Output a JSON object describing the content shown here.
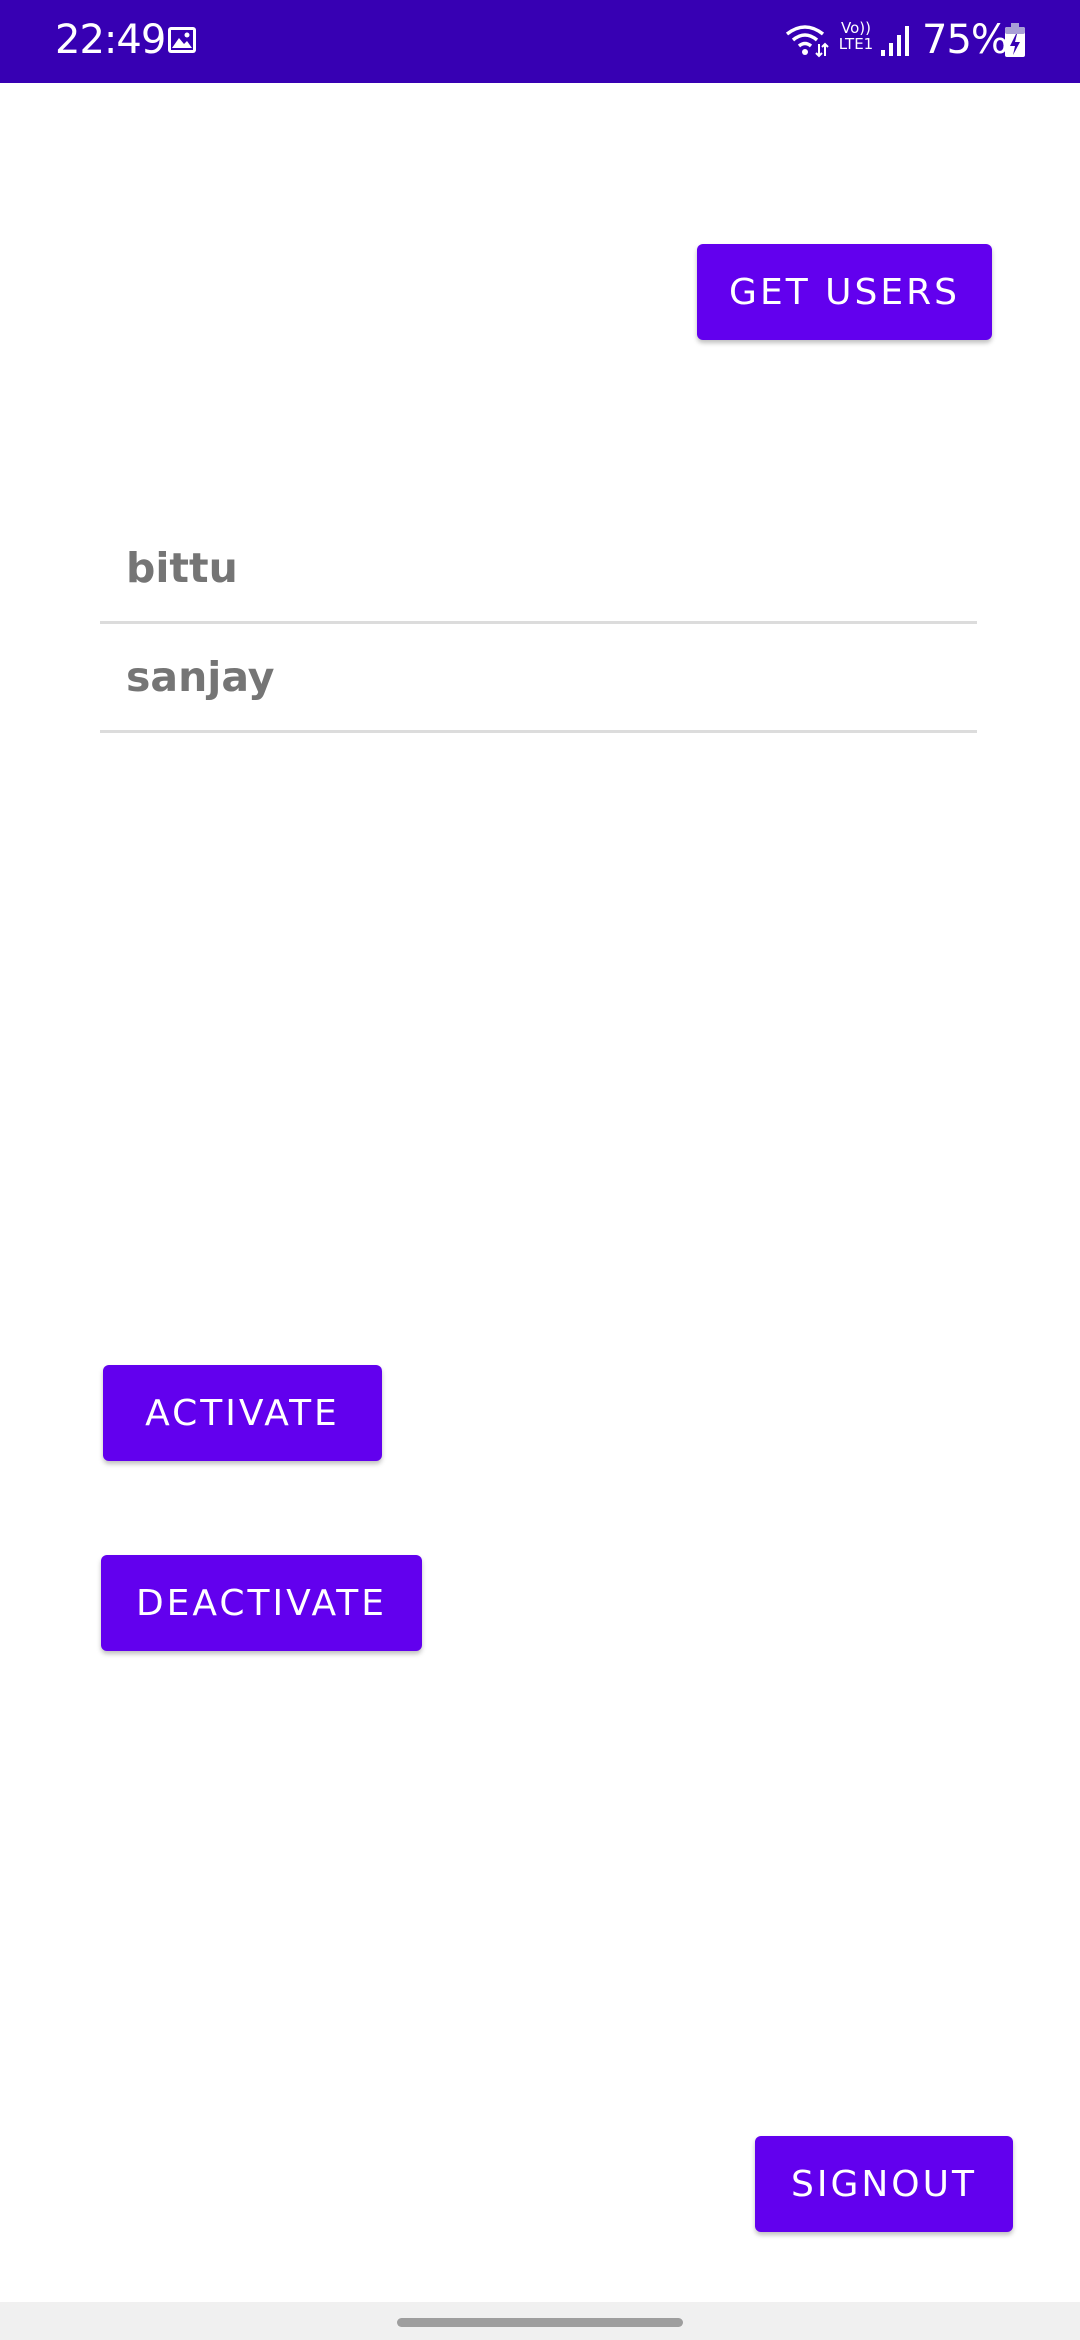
{
  "status_bar": {
    "time": "22:49",
    "volte_top": "Vo))",
    "volte_bottom": "LTE1",
    "battery": "75%",
    "icons": [
      "gallery-icon",
      "wifi-icon",
      "signal-icon",
      "battery-charging-icon"
    ]
  },
  "buttons": {
    "get_users": "GET USERS",
    "activate": "ACTIVATE",
    "deactivate": "DEACTIVATE",
    "signout": "SIGNOUT"
  },
  "users": [
    "bittu",
    "sanjay"
  ],
  "colors": {
    "status_bar": "#3700b3",
    "primary": "#6200ee",
    "list_text": "#757575",
    "divider": "#dcdcdc"
  }
}
